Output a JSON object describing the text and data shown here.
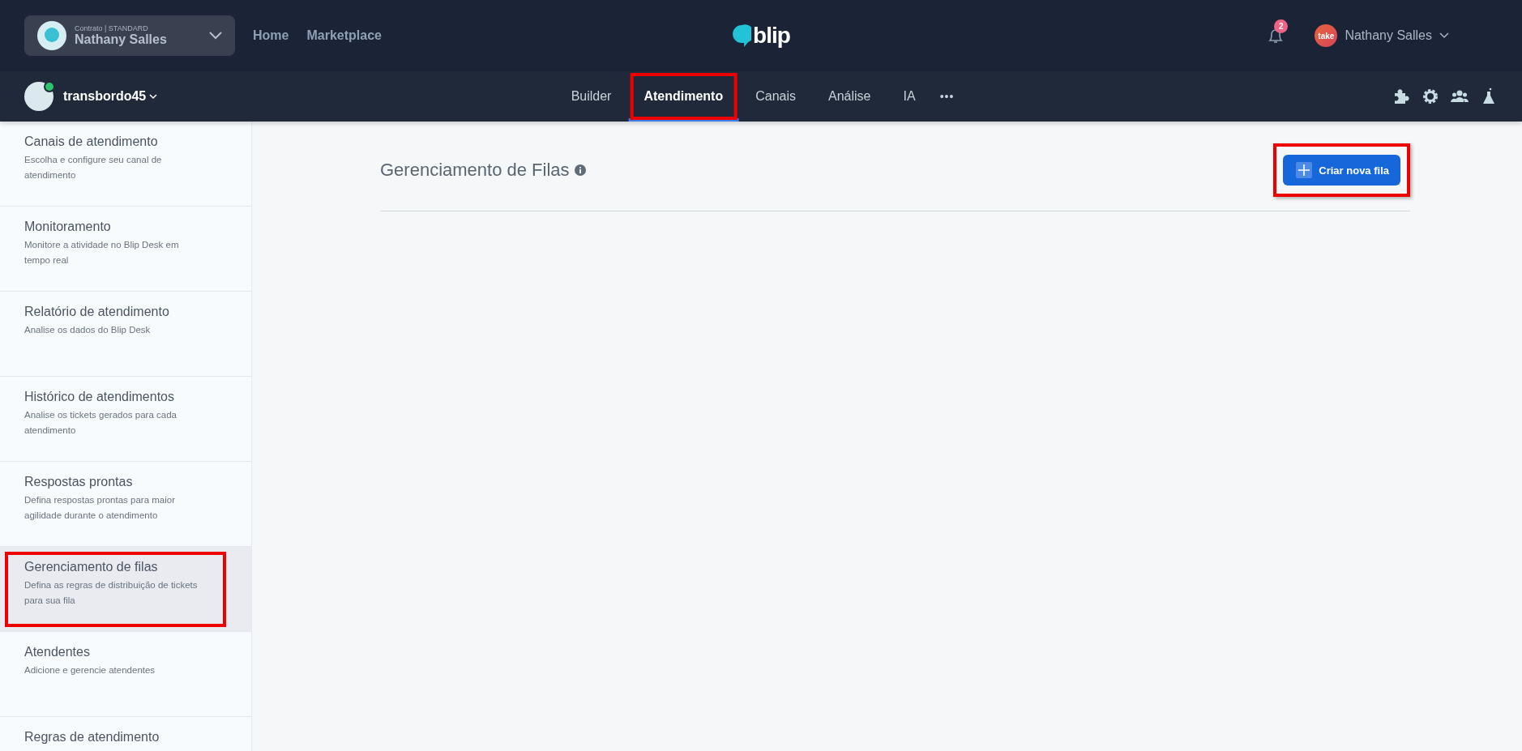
{
  "top_bar": {
    "contract": {
      "label": "Contrato | STANDARD",
      "name": "Nathany Salles"
    },
    "links": [
      "Home",
      "Marketplace"
    ],
    "logo": "blip",
    "notifications": {
      "count": "2"
    },
    "user": {
      "avatar": "take",
      "name": "Nathany Salles"
    }
  },
  "bot_bar": {
    "bot_name": "transbordo45",
    "online": true,
    "tabs": [
      {
        "label": "Builder",
        "selected": false,
        "highlighted": false
      },
      {
        "label": "Atendimento",
        "selected": true,
        "highlighted": true
      },
      {
        "label": "Canais",
        "selected": false,
        "highlighted": false
      },
      {
        "label": "Análise",
        "selected": false,
        "highlighted": false
      },
      {
        "label": "IA",
        "selected": false,
        "highlighted": false
      }
    ],
    "more": "•••"
  },
  "sidebar": {
    "items": [
      {
        "title": "Canais de atendimento",
        "description": "Escolha e configure seu canal de atendimento",
        "selected": false,
        "highlighted": false
      },
      {
        "title": "Monitoramento",
        "description": "Monitore a atividade no Blip Desk em tempo real",
        "selected": false,
        "highlighted": false
      },
      {
        "title": "Relatório de atendimento",
        "description": "Analise os dados do Blip Desk",
        "selected": false,
        "highlighted": false
      },
      {
        "title": "Histórico de atendimentos",
        "description": "Analise os tickets gerados para cada atendimento",
        "selected": false,
        "highlighted": false
      },
      {
        "title": "Respostas prontas",
        "description": "Defina respostas prontas para maior agilidade durante o atendimento",
        "selected": false,
        "highlighted": false
      },
      {
        "title": "Gerenciamento de filas",
        "description": "Defina as regras de distribuição de tickets para sua fila",
        "selected": true,
        "highlighted": true
      },
      {
        "title": "Atendentes",
        "description": "Adicione e gerencie atendentes",
        "selected": false,
        "highlighted": false
      },
      {
        "title": "Regras de atendimento",
        "selected": false,
        "highlighted": false
      }
    ]
  },
  "main": {
    "title": "Gerenciamento de Filas",
    "button": {
      "label": "Criar nova fila",
      "highlighted": true
    }
  }
}
